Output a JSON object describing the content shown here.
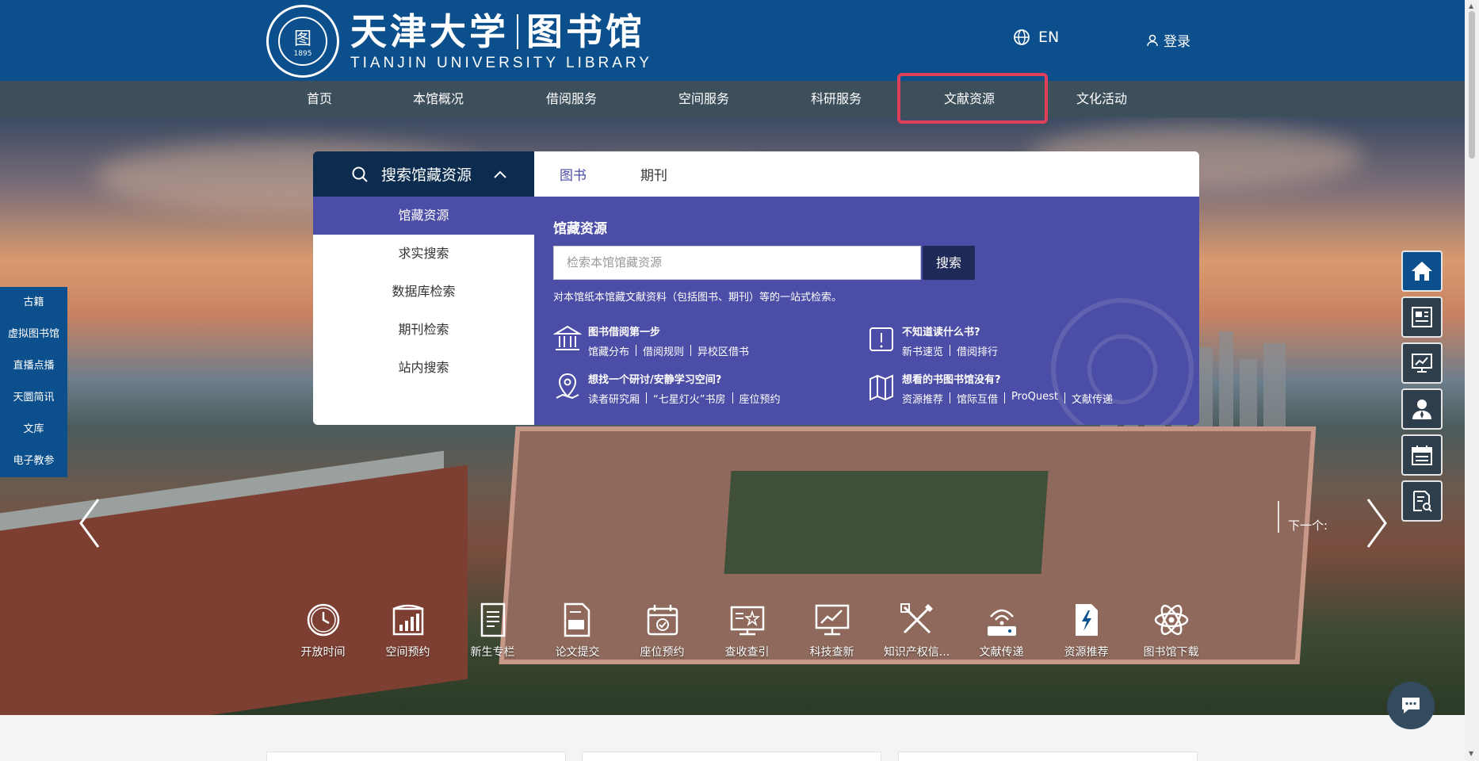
{
  "header": {
    "logo_cn": "天津大学",
    "logo_cn2": "图书馆",
    "logo_en": "TIANJIN UNIVERSITY LIBRARY",
    "seal_year": "1895",
    "seal_glyph": "图",
    "lang_label": "EN",
    "login_label": "登录"
  },
  "nav": {
    "items": [
      "首页",
      "本馆概况",
      "借阅服务",
      "空间服务",
      "科研服务",
      "文献资源",
      "文化活动"
    ],
    "highlighted": "文献资源"
  },
  "search": {
    "header_label": "搜索馆藏资源",
    "menu": [
      "馆藏资源",
      "求实搜索",
      "数据库检索",
      "期刊检索",
      "站内搜索"
    ],
    "active_menu": "馆藏资源",
    "tabs": [
      "图书",
      "期刊"
    ],
    "active_tab": "图书",
    "panel_title": "馆藏资源",
    "input_placeholder": "检索本馆馆藏资源",
    "button_label": "搜索",
    "note": "对本馆纸本馆藏文献资料（包括图书、期刊）等的一站式检索。",
    "quick_links": [
      {
        "icon": "library-building-icon",
        "title": "图书借阅第一步",
        "subs": [
          "馆藏分布",
          "借阅规则",
          "异校区借书"
        ]
      },
      {
        "icon": "book-question-icon",
        "title": "不知道读什么书?",
        "subs": [
          "新书速览",
          "借阅排行"
        ]
      },
      {
        "icon": "location-pin-icon",
        "title": "想找一个研讨/安静学习空间?",
        "subs": [
          "读者研究厢",
          "“七星灯火”书房",
          "座位预约"
        ]
      },
      {
        "icon": "map-icon",
        "title": "想看的书图书馆没有?",
        "subs": [
          "资源推荐",
          "馆际互借",
          "ProQuest",
          "文献传递"
        ]
      }
    ]
  },
  "left_sidebar": [
    "古籍",
    "虚拟图书馆",
    "直播点播",
    "天圜简讯",
    "文库",
    "电子教参"
  ],
  "right_icons": [
    "home-icon",
    "news-icon",
    "screen-chart-icon",
    "librarian-icon",
    "calendar-icon",
    "document-search-icon"
  ],
  "carousel": {
    "next_label": "下一个:"
  },
  "quick_row": [
    {
      "icon": "clock-icon",
      "label": "开放时间"
    },
    {
      "icon": "space-booking-icon",
      "label": "空间预约"
    },
    {
      "icon": "newcomer-doc-icon",
      "label": "新生专栏"
    },
    {
      "icon": "thesis-submit-icon",
      "label": "论文提交"
    },
    {
      "icon": "seat-booking-icon",
      "label": "座位预约"
    },
    {
      "icon": "citation-search-icon",
      "label": "查收查引"
    },
    {
      "icon": "novelty-search-icon",
      "label": "科技查新"
    },
    {
      "icon": "ip-info-icon",
      "label": "知识产权信..."
    },
    {
      "icon": "document-delivery-icon",
      "label": "文献传递"
    },
    {
      "icon": "resource-recommend-icon",
      "label": "资源推荐"
    },
    {
      "icon": "atom-download-icon",
      "label": "图书馆下载"
    }
  ],
  "colors": {
    "header_bg": "#0b4f8c",
    "nav_bg": "#3e4f5c",
    "panel_purple": "#4b4da6",
    "highlight_red": "#e0405a"
  }
}
